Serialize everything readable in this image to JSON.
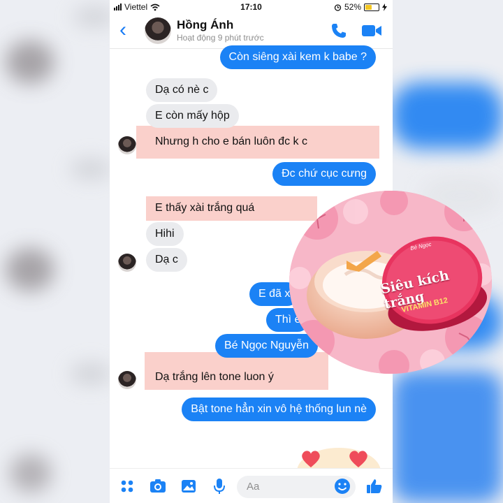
{
  "status_bar": {
    "carrier": "Viettel",
    "time": "17:10",
    "battery": "52%"
  },
  "header": {
    "back_icon": "chevron-left-icon",
    "contact_name": "Hồng Ánh",
    "active_status": "Hoạt động 9 phút trước"
  },
  "messages": [
    {
      "side": "out",
      "text": "Còn siêng xài kem k babe ?"
    },
    {
      "side": "in",
      "text": "Dạ có nè c"
    },
    {
      "side": "in",
      "text": "E còn mấy hộp"
    },
    {
      "side": "in",
      "text": "Nhưng h cho e bán luôn đc k c",
      "highlighted": true
    },
    {
      "side": "out",
      "text": "Đc chứ cục cưng"
    },
    {
      "side": "in",
      "text": "E thấy xài trắng quá",
      "highlighted": true
    },
    {
      "side": "in",
      "text": "Hihi"
    },
    {
      "side": "in",
      "text": "Dạ c"
    },
    {
      "side": "out",
      "text": "E đã x"
    },
    {
      "side": "out",
      "text": "Thì e"
    },
    {
      "side": "out",
      "text": "Bé Ngọc Nguyễn"
    },
    {
      "side": "in",
      "text": "Dạ trắng lên tone luon ý",
      "highlighted": true
    },
    {
      "side": "out",
      "text": "Bật tone hẳn xin vô hệ thống lun nè"
    }
  ],
  "product": {
    "brand_script": "Bé Ngọc",
    "name": "Siêu kích trắng",
    "sub_label": "VITAMIN B12"
  },
  "composer": {
    "placeholder": "Aa"
  },
  "colors": {
    "accent": "#1b82f5",
    "incoming_bubble": "#eaebee",
    "highlight": "#f4968c",
    "product_pink": "#e8345f"
  }
}
